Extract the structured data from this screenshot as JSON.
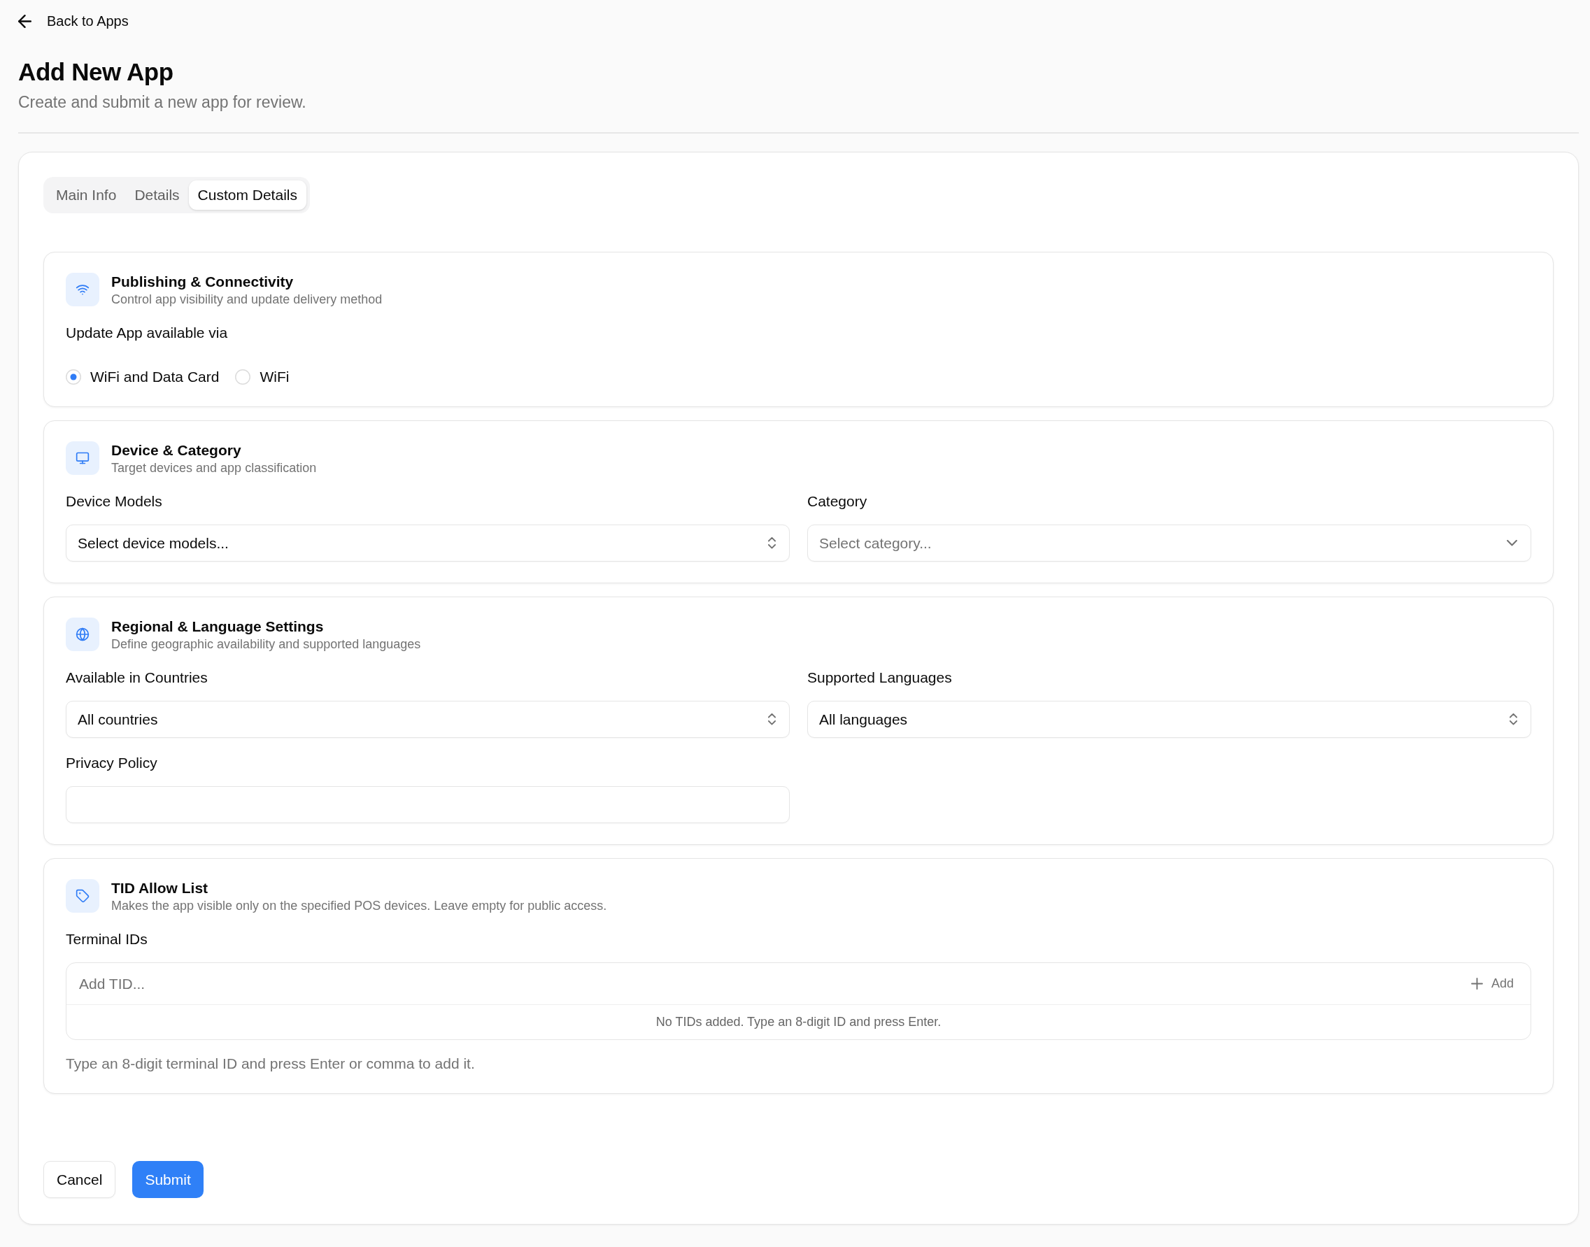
{
  "back_link": {
    "label": "Back to Apps"
  },
  "header": {
    "title": "Add New App",
    "subtitle": "Create and submit a new app for review."
  },
  "tabs": [
    {
      "label": "Main Info",
      "selected": false
    },
    {
      "label": "Details",
      "selected": false
    },
    {
      "label": "Custom Details",
      "selected": true
    }
  ],
  "sections": [
    {
      "title": "Publishing & Connectivity",
      "subtitle": "Control app visibility and update delivery method",
      "fields": [
        {
          "kind": "radio",
          "label": "Update App available via",
          "options": [
            {
              "label": "WiFi and Data Card",
              "selected": true
            },
            {
              "label": "WiFi",
              "selected": false
            }
          ]
        }
      ]
    },
    {
      "title": "Device & Category",
      "subtitle": "Target devices and app classification",
      "fields": [
        {
          "kind": "combobox",
          "label": "Device Models",
          "value": "Select device models..."
        },
        {
          "kind": "select",
          "label": "Category",
          "placeholder": "Select category..."
        }
      ]
    },
    {
      "title": "Regional & Language Settings",
      "subtitle": "Define geographic availability and supported languages",
      "fields": [
        {
          "kind": "combobox",
          "label": "Available in Countries",
          "value": "All countries"
        },
        {
          "kind": "combobox",
          "label": "Supported Languages",
          "value": "All languages"
        },
        {
          "kind": "text",
          "label": "Privacy Policy"
        }
      ]
    },
    {
      "title": "TID Allow List",
      "subtitle": "Makes the app visible only on the specified POS devices. Leave empty for public access.",
      "fields": [
        {
          "kind": "tags",
          "label": "Terminal IDs",
          "placeholder": "Add TID...",
          "add_button": "Add",
          "empty_message": "No TIDs added. Type an 8-digit ID and press Enter.",
          "hint": "Type an 8-digit terminal ID and press Enter or comma to add it."
        }
      ]
    }
  ],
  "footer": {
    "buttons": [
      {
        "label": "Cancel",
        "kind": "secondary"
      },
      {
        "label": "Submit",
        "kind": "primary"
      }
    ]
  }
}
